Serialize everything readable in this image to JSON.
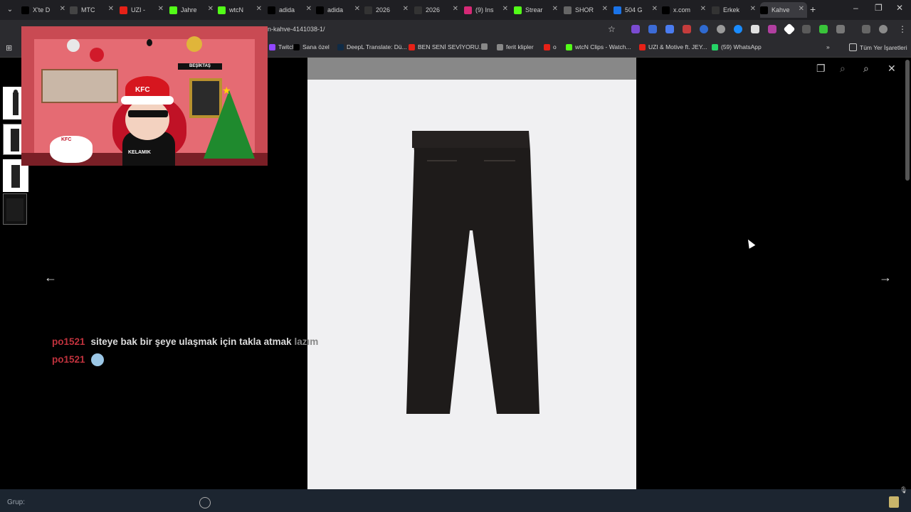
{
  "tabs": [
    {
      "title": "X'te D",
      "icon": "x-icon",
      "color": "#000000"
    },
    {
      "title": "MTC",
      "icon": "tab-icon",
      "color": "#444444"
    },
    {
      "title": "UZI -",
      "icon": "youtube-icon",
      "color": "#e62117"
    },
    {
      "title": "Jahre",
      "icon": "kick-icon",
      "color": "#53fc18"
    },
    {
      "title": "wtcN",
      "icon": "kick-icon",
      "color": "#53fc18"
    },
    {
      "title": "adida",
      "icon": "adidas-icon",
      "color": "#000000"
    },
    {
      "title": "adida",
      "icon": "adidas-icon",
      "color": "#000000"
    },
    {
      "title": "2026",
      "icon": "tab-icon",
      "color": "#333333"
    },
    {
      "title": "2026",
      "icon": "tab-icon",
      "color": "#333333"
    },
    {
      "title": "(9) Ins",
      "icon": "instagram-icon",
      "color": "#d62976"
    },
    {
      "title": "Strear",
      "icon": "kick-icon",
      "color": "#53fc18"
    },
    {
      "title": "SHOR",
      "icon": "globe-icon",
      "color": "#666666"
    },
    {
      "title": "504 G",
      "icon": "tab-icon",
      "color": "#1a73e8"
    },
    {
      "title": "x.com",
      "icon": "x-icon",
      "color": "#000000"
    },
    {
      "title": "Erkek",
      "icon": "tab-icon",
      "color": "#333333"
    },
    {
      "title": "Kahve",
      "icon": "tab-icon",
      "color": "#000000"
    }
  ],
  "address": {
    "url": "n-kahve-4141038-1/"
  },
  "bookmarks": [
    {
      "label": "Twitch",
      "color": "#9146ff"
    },
    {
      "label": "Sana özel",
      "color": "#000000"
    },
    {
      "label": "DeepL Translate: Dü...",
      "color": "#0f2b46"
    },
    {
      "label": "BEN SENİ SEVİYORU...",
      "color": "#e62117"
    },
    {
      "label": "",
      "color": "#888888"
    },
    {
      "label": "ferit klipler",
      "color": "#888888"
    },
    {
      "label": "o",
      "color": "#e62117"
    },
    {
      "label": "wtcN Clips - Watch...",
      "color": "#53fc18"
    },
    {
      "label": "UZI & Motive ft. JEY...",
      "color": "#e62117"
    },
    {
      "label": "(59) WhatsApp",
      "color": "#25d366"
    }
  ],
  "bookmarks_more": "»",
  "all_bookmarks": "Tüm Yer İşaretleri",
  "overlay": {
    "banner": "BEŞİKTAŞ",
    "hat_text": "KFC",
    "body_text": "KELAMIK",
    "small_kfc": "KFC"
  },
  "chat": [
    {
      "user": "po1521",
      "message": "siteye bak bir şeye ulaşmak için takla atmak ",
      "faded": "lazım",
      "emote": false
    },
    {
      "user": "po1521",
      "message": "",
      "faded": "",
      "emote": true
    }
  ],
  "bottom": {
    "placeholder": "Grup:"
  }
}
